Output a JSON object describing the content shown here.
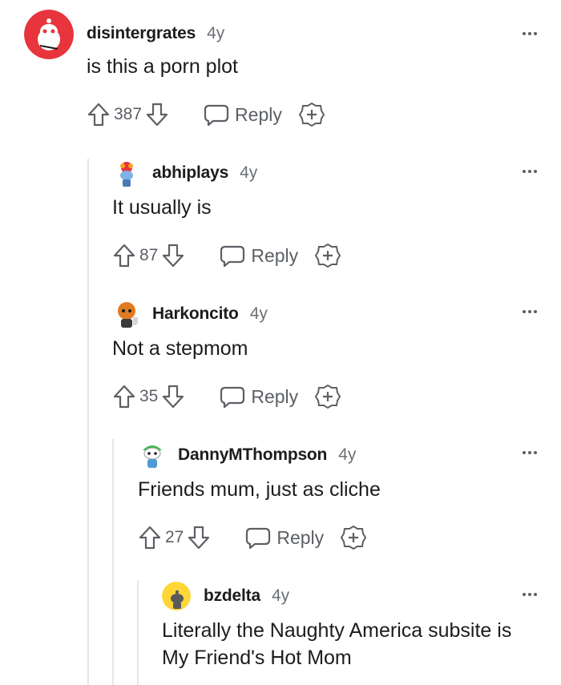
{
  "comments": [
    {
      "username": "disintergrates",
      "age": "4y",
      "text": "is this a porn plot",
      "score": "387",
      "reply_label": "Reply"
    },
    {
      "username": "abhiplays",
      "age": "4y",
      "text": "It usually is",
      "score": "87",
      "reply_label": "Reply"
    },
    {
      "username": "Harkoncito",
      "age": "4y",
      "text": "Not a stepmom",
      "score": "35",
      "reply_label": "Reply"
    },
    {
      "username": "DannyMThompson",
      "age": "4y",
      "text": "Friends mum, just as cliche",
      "score": "27",
      "reply_label": "Reply"
    },
    {
      "username": "bzdelta",
      "age": "4y",
      "text": "Literally the Naughty America subsite is My Friend's Hot Mom",
      "score": "",
      "reply_label": ""
    }
  ],
  "icons": {
    "upvote": "arrow-up-icon",
    "downvote": "arrow-down-icon",
    "reply": "speech-bubble-icon",
    "award": "award-plus-icon",
    "more": "ellipsis-icon"
  },
  "colors": {
    "avatar_red": "#e8343c",
    "text": "#1c1c1c",
    "muted": "#5c6065",
    "thread_line": "#e4e6e8"
  }
}
